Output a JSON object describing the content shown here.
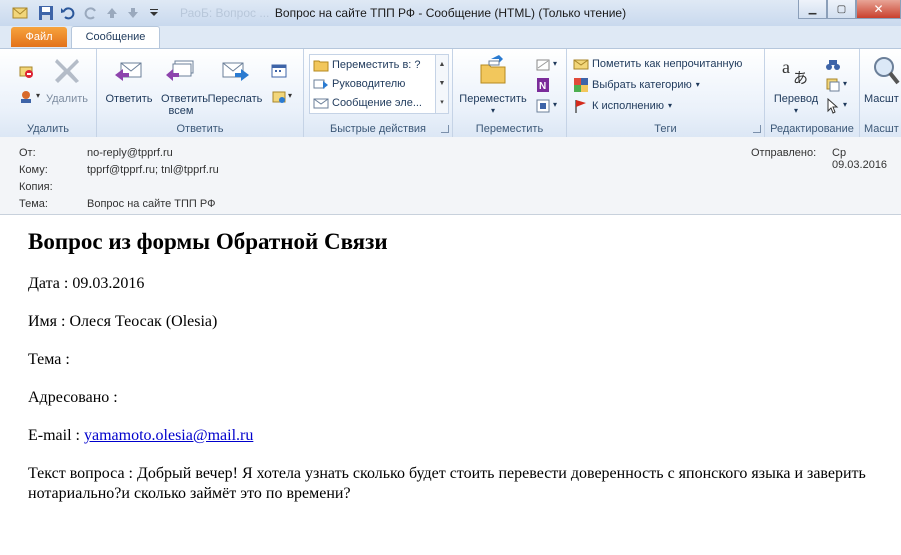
{
  "window": {
    "title": "Вопрос на сайте ТПП РФ  -  Сообщение (HTML) (Только чтение)",
    "faded_title": "РаоБ: Вопрос ..."
  },
  "tabs": [
    {
      "label": "Файл"
    },
    {
      "label": "Сообщение"
    }
  ],
  "ribbon": {
    "delete_group": {
      "label": "Удалить",
      "delete_button": "Удалить"
    },
    "reply_group": {
      "label": "Ответить",
      "reply": "Ответить",
      "reply_all": "Ответить всем",
      "forward": "Переслать"
    },
    "quick_steps": {
      "label": "Быстрые действия",
      "items": [
        "Переместить в: ?",
        "Руководителю",
        "Сообщение эле..."
      ]
    },
    "move_group": {
      "label": "Переместить",
      "move_button": "Переместить"
    },
    "tags_group": {
      "label": "Теги",
      "items": [
        "Пометить как непрочитанную",
        "Выбрать категорию",
        "К исполнению"
      ]
    },
    "editing_group": {
      "label": "Редактирование",
      "translate": "Перевод"
    },
    "zoom_group": {
      "label": "Масшт",
      "zoom": "Масшт"
    }
  },
  "header": {
    "from_label": "От:",
    "from_value": "no-reply@tpprf.ru",
    "to_label": "Кому:",
    "to_value": "tpprf@tpprf.ru; tnl@tpprf.ru",
    "cc_label": "Копия:",
    "cc_value": "",
    "subject_label": "Тема:",
    "subject_value": "Вопрос на сайте ТПП РФ",
    "sent_label": "Отправлено:",
    "sent_value": "Ср 09.03.2016"
  },
  "body": {
    "heading": "Вопрос из формы Обратной Связи",
    "date": "Дата : 09.03.2016",
    "name": "Имя : Олеся Теосак (Olesia)",
    "topic": "Тема :",
    "addressed": "Адресовано :",
    "email_label": "E-mail : ",
    "email_link": "yamamoto.olesia@mail.ru",
    "question_line1": "Текст вопроса : Добрый вечер! Я хотела узнать сколько будет стоить перевести доверенность с японского языка и заверить",
    "question_line2": "нотариально?и сколько займёт это по времени?"
  }
}
